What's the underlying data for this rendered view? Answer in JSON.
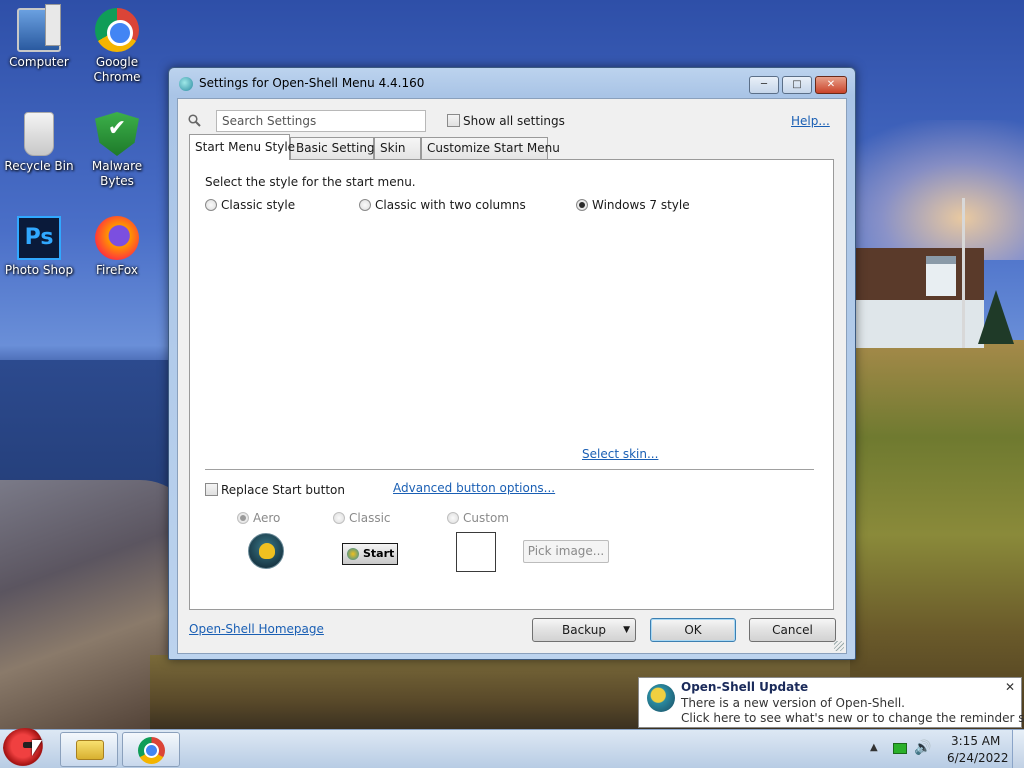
{
  "desktop": {
    "icons": [
      {
        "label": "Computer",
        "icon": "computer-icon"
      },
      {
        "label": "Google Chrome",
        "icon": "chrome-icon"
      },
      {
        "label": "Recycle Bin",
        "icon": "recycle-bin-icon"
      },
      {
        "label": "Malware Bytes",
        "icon": "malwarebytes-icon"
      },
      {
        "label": "Photo Shop",
        "icon": "photoshop-icon"
      },
      {
        "label": "FireFox",
        "icon": "firefox-icon"
      }
    ],
    "photoshop_glyph": "Ps"
  },
  "window": {
    "title": "Settings for Open-Shell Menu 4.4.160",
    "search_placeholder": "Search Settings",
    "show_all_label": "Show all settings",
    "help_link": "Help...",
    "tabs": [
      {
        "label": "Start Menu Style",
        "active": true
      },
      {
        "label": "Basic Settings",
        "active": false
      },
      {
        "label": "Skin",
        "active": false
      },
      {
        "label": "Customize Start Menu",
        "active": false
      }
    ],
    "style_prompt": "Select the style for the start menu.",
    "styles": [
      {
        "label": "Classic style",
        "selected": false
      },
      {
        "label": "Classic with two columns",
        "selected": false
      },
      {
        "label": "Windows 7 style",
        "selected": true
      }
    ],
    "select_skin_link": "Select skin...",
    "replace_start_label": "Replace Start button",
    "advanced_button_link": "Advanced button options...",
    "button_styles": [
      {
        "label": "Aero",
        "selected": true
      },
      {
        "label": "Classic",
        "selected": false
      },
      {
        "label": "Custom",
        "selected": false
      }
    ],
    "classic_button_text": "Start",
    "pick_image_label": "Pick image...",
    "homepage_link": "Open-Shell Homepage",
    "backup_label": "Backup",
    "ok_label": "OK",
    "cancel_label": "Cancel"
  },
  "notification": {
    "title": "Open-Shell Update",
    "line1": "There is a new version of Open-Shell.",
    "line2": "Click here to see what's new or to change the reminder settings.",
    "close_glyph": "✕"
  },
  "taskbar": {
    "time": "3:15 AM",
    "date": "6/24/2022",
    "chevron": "▲",
    "volume": "🔊"
  },
  "colors": {
    "link": "#1a5fb4",
    "title_bar": "#a9c4e6",
    "close_button": "#c9432a",
    "notify_title": "#1a2a5a"
  }
}
